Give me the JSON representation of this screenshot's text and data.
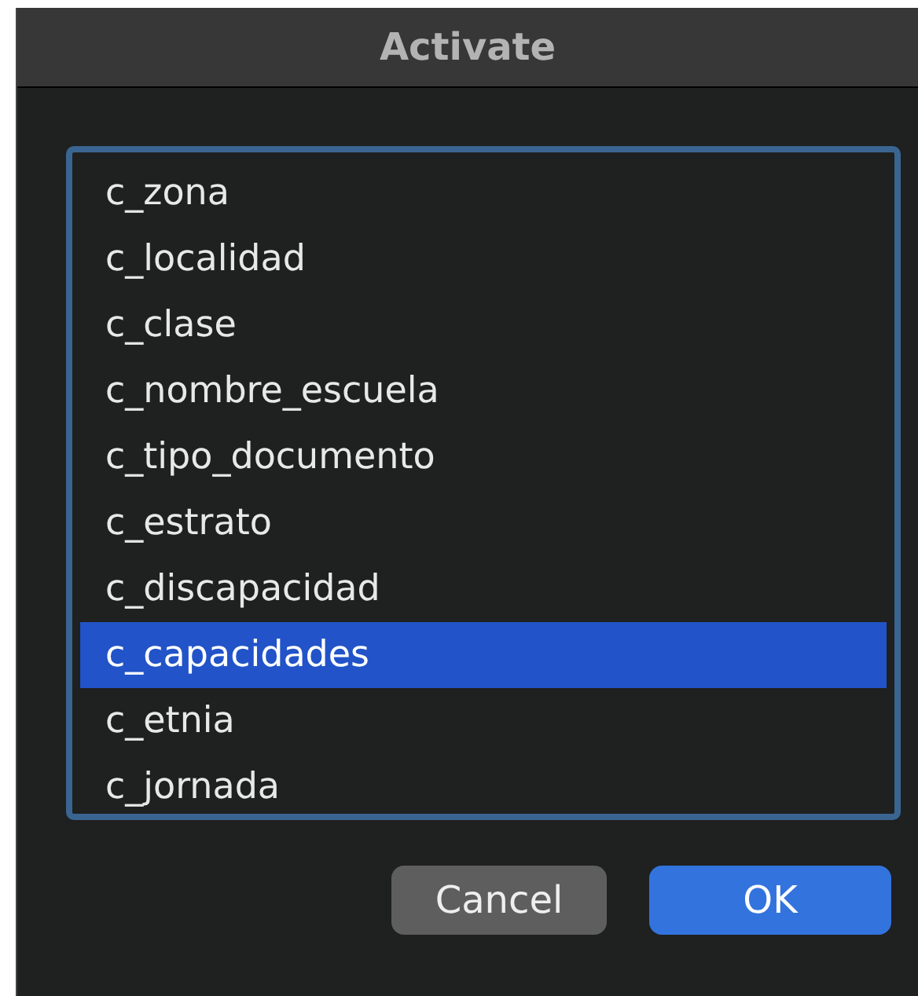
{
  "window": {
    "title": "Activate"
  },
  "list": {
    "items": [
      {
        "label": "c_zona",
        "selected": false
      },
      {
        "label": "c_localidad",
        "selected": false
      },
      {
        "label": "c_clase",
        "selected": false
      },
      {
        "label": "c_nombre_escuela",
        "selected": false
      },
      {
        "label": "c_tipo_documento",
        "selected": false
      },
      {
        "label": "c_estrato",
        "selected": false
      },
      {
        "label": "c_discapacidad",
        "selected": false
      },
      {
        "label": "c_capacidades",
        "selected": true
      },
      {
        "label": "c_etnia",
        "selected": false
      },
      {
        "label": "c_jornada",
        "selected": false
      }
    ]
  },
  "buttons": [
    {
      "label": "Cancel",
      "kind": "secondary"
    },
    {
      "label": "OK",
      "kind": "default"
    }
  ]
}
